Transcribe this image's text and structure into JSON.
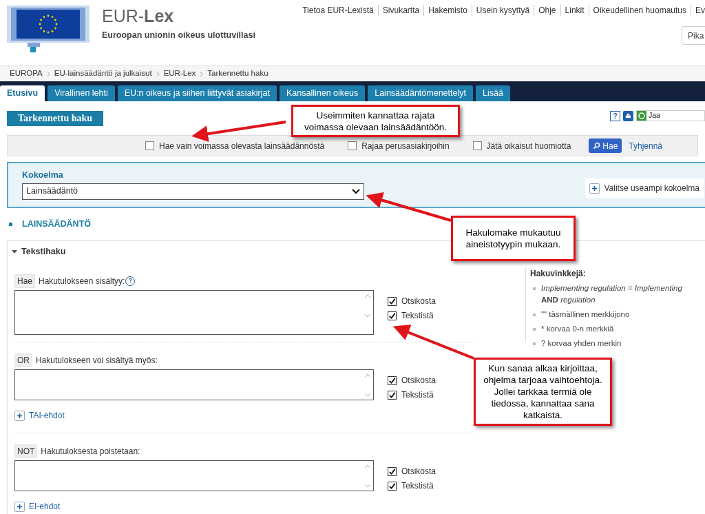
{
  "header": {
    "site_title": "EUR-**Lex**",
    "tagline": "Euroopan unionin oikeus ulottuvillasi",
    "top_links": [
      "Tietoa EUR-Lexistä",
      "Sivukartta",
      "Hakemisto",
      "Usein kysyttyä",
      "Ohje",
      "Linkit",
      "Oikeudellinen huomautus",
      "Ev"
    ],
    "search": {
      "placeholder": "Pika"
    }
  },
  "breadcrumb": [
    "EUROPA",
    "EU-lainsäädäntö ja julkaisut",
    "EUR-Lex",
    "Tarkennettu haku"
  ],
  "tabs": [
    {
      "label": "Etusivu",
      "selected": true
    },
    {
      "label": "Virallinen lehti",
      "selected": false
    },
    {
      "label": "EU:n oikeus ja siihen liittyvät asiakirjat",
      "selected": false
    },
    {
      "label": "Kansallinen oikeus",
      "selected": false
    },
    {
      "label": "Lainsäädäntömenettelyt",
      "selected": false
    },
    {
      "label": "Lisää",
      "selected": false
    }
  ],
  "page_title": "Tarkennettu haku",
  "toolbar": {
    "help": "?",
    "share_label": "Jaa"
  },
  "options": [
    {
      "label": "Hae vain voimassa olevasta lainsäädännöstä",
      "checked": false
    },
    {
      "label": "Rajaa perusasiakirjoihin",
      "checked": false
    },
    {
      "label": "Jätä oikaisut huomiotta",
      "checked": false
    }
  ],
  "search_button": "Hae",
  "clear_link": "Tyhjennä",
  "collection": {
    "label": "Kokoelma",
    "value": "Lainsäädäntö",
    "more_button": "Valitse useampi kokoelma"
  },
  "section_heading": "LAINSÄÄDÄNTÖ",
  "text_search": {
    "title": "Tekstihaku",
    "expanded": true,
    "fields": [
      {
        "operator": "Hae",
        "label": "Hakutulokseen sisältyy:",
        "help": "?",
        "scopes": [
          {
            "label": "Otsikosta",
            "checked": true
          },
          {
            "label": "Tekstistä",
            "checked": true
          }
        ]
      },
      {
        "operator": "OR",
        "label": "Hakutulokseen voi sisältyä myös:",
        "scopes": [
          {
            "label": "Otsikosta",
            "checked": true
          },
          {
            "label": "Tekstistä",
            "checked": true
          }
        ],
        "add_link": "TAI-ehdot"
      },
      {
        "operator": "NOT",
        "label": "Hakutuloksesta poistetaan:",
        "scopes": [
          {
            "label": "Otsikosta",
            "checked": true
          },
          {
            "label": "Tekstistä",
            "checked": true
          }
        ],
        "add_link": "EI-ehdot"
      }
    ],
    "hints": {
      "title": "Hakuvinkkejä:",
      "items": [
        "*Implementing regulation = Implementing* **AND** *regulation*",
        "\"\" täsmällinen merkkijono",
        "* korvaa 0-n merkkiä",
        "? korvaa yhden merkin"
      ]
    }
  },
  "callouts": [
    "Useimmiten kannattaa rajata voimassa olevaan lainsäädäntöön.",
    "Hakulomake mukautuu aineistotyypin mukaan.",
    "Kun sanaa alkaa kirjoittaa, ohjelma tarjoaa vaihtoehtoja. Jollei tarkkaa termiä ole tiedossa, kannattaa sana katkaista."
  ]
}
